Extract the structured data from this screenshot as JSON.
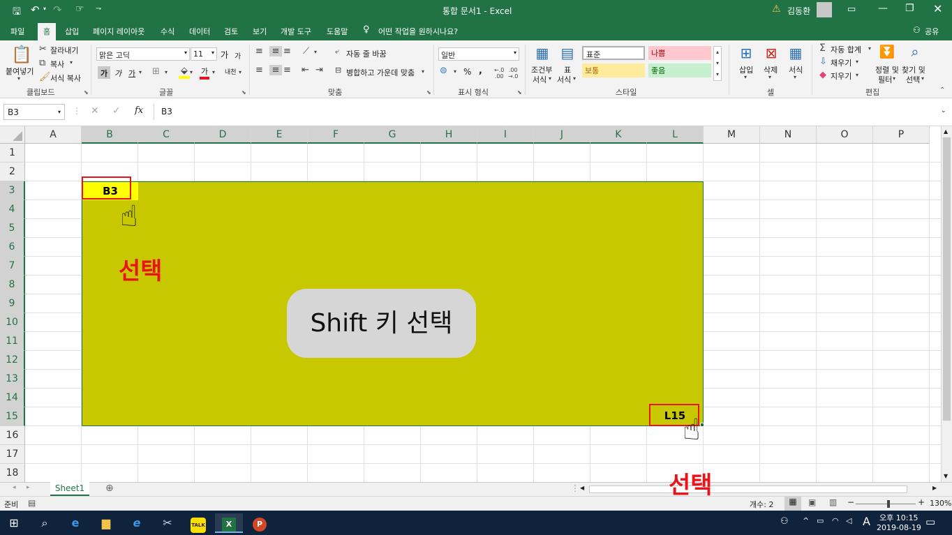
{
  "titlebar": {
    "title": "통합 문서1  -  Excel",
    "user": "김동환",
    "qat_more": "⇁"
  },
  "tabs": [
    "파일",
    "홈",
    "삽입",
    "페이지 레이아웃",
    "수식",
    "데이터",
    "검토",
    "보기",
    "개발 도구",
    "도움말"
  ],
  "tell_me": "어떤 작업을 원하시나요?",
  "share": "공유",
  "ribbon": {
    "clipboard": {
      "paste": "붙여넣기",
      "cut": "잘라내기",
      "copy": "복사",
      "format_painter": "서식 복사",
      "group": "클립보드"
    },
    "font": {
      "name": "맑은 고딕",
      "size": "11",
      "bold": "가",
      "italic": "가",
      "underline": "가",
      "grow": "가",
      "shrink": "가",
      "color_label": "가",
      "phonetic": "내천",
      "group": "글꼴"
    },
    "align": {
      "wrap": "자동 줄 바꿈",
      "merge": "병합하고 가운데 맞춤",
      "group": "맞춤"
    },
    "number": {
      "format": "일반",
      "percent": "%",
      "comma": ",",
      "group": "표시 형식"
    },
    "styles": {
      "cond": "조건부",
      "cond2": "서식",
      "table": "표",
      "table2": "서식",
      "normal": "표준",
      "bad": "나쁨",
      "neutral": "보통",
      "good": "좋음",
      "group": "스타일"
    },
    "cells": {
      "insert": "삽입",
      "delete": "삭제",
      "format": "서식",
      "group": "셀"
    },
    "editing": {
      "autosum": "자동 합계",
      "fill": "채우기",
      "clear": "지우기",
      "sort": "정렬 및",
      "sort2": "필터",
      "find": "찾기 및",
      "find2": "선택",
      "group": "편집"
    }
  },
  "formula_bar": {
    "name_box": "B3",
    "content": "B3",
    "fx": "fx"
  },
  "columns": [
    "A",
    "B",
    "C",
    "D",
    "E",
    "F",
    "G",
    "H",
    "I",
    "J",
    "K",
    "L",
    "M",
    "N",
    "O",
    "P"
  ],
  "rows": [
    "1",
    "2",
    "3",
    "4",
    "5",
    "6",
    "7",
    "8",
    "9",
    "10",
    "11",
    "12",
    "13",
    "14",
    "15",
    "16",
    "17",
    "18"
  ],
  "cells": {
    "b3": "B3",
    "l15": "L15"
  },
  "annotations": {
    "select1": "선택",
    "select2": "선택",
    "shift_label": "Shift 키 선택"
  },
  "colors": {
    "excel_green": "#217346",
    "selection_fill": "#c8c800",
    "b3_fill": "#ffff00",
    "annot_red": "#e8141a"
  },
  "sheet_tab": "Sheet1",
  "status": {
    "ready": "준비",
    "count": "개수: 2",
    "zoom": "130%"
  },
  "taskbar": {
    "time": "오후 10:15",
    "date": "2019-08-19",
    "ime": "A"
  }
}
